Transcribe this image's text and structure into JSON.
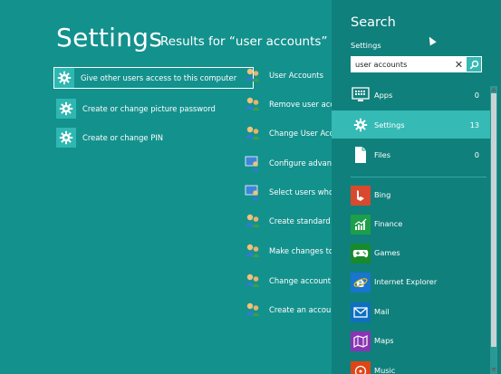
{
  "page": {
    "title": "Settings",
    "subtitle": "Results for “user accounts”"
  },
  "results_left": [
    {
      "label": "Give other users access to this computer",
      "icon": "gear-icon",
      "selected": true
    },
    {
      "label": "Create or change picture password",
      "icon": "gear-icon"
    },
    {
      "label": "Create or change PIN",
      "icon": "gear-icon"
    }
  ],
  "results_right": [
    {
      "label": "User Accounts",
      "icon": "user-accounts-icon"
    },
    {
      "label": "Remove user accoun",
      "icon": "user-accounts-icon"
    },
    {
      "label": "Change User Accou",
      "icon": "user-accounts-icon"
    },
    {
      "label": "Configure advance",
      "icon": "user-accounts-icon"
    },
    {
      "label": "Select users who ca",
      "icon": "user-accounts-icon"
    },
    {
      "label": "Create standard use",
      "icon": "user-accounts-icon"
    },
    {
      "label": "Make changes to ac",
      "icon": "user-accounts-icon"
    },
    {
      "label": "Change account typ",
      "icon": "user-accounts-icon"
    },
    {
      "label": "Create an account",
      "icon": "user-accounts-icon"
    }
  ],
  "search_pane": {
    "title": "Search",
    "scope_label": "Settings",
    "query": "user accounts",
    "categories": [
      {
        "label": "Apps",
        "count": "0",
        "icon": "apps-icon"
      },
      {
        "label": "Settings",
        "count": "13",
        "icon": "gear-icon",
        "active": true
      },
      {
        "label": "Files",
        "count": "0",
        "icon": "file-icon"
      }
    ],
    "apps": [
      {
        "label": "Bing",
        "icon": "bing-icon",
        "color": "#d9492e"
      },
      {
        "label": "Finance",
        "icon": "finance-icon",
        "color": "#1d9e48"
      },
      {
        "label": "Games",
        "icon": "games-icon",
        "color": "#178a2c"
      },
      {
        "label": "Internet Explorer",
        "icon": "internet-explorer-icon",
        "color": "#1a74d1"
      },
      {
        "label": "Mail",
        "icon": "mail-icon",
        "color": "#0e6fc1"
      },
      {
        "label": "Maps",
        "icon": "maps-icon",
        "color": "#8a34b4"
      },
      {
        "label": "Music",
        "icon": "music-icon",
        "color": "#df4516"
      }
    ]
  },
  "colors": {
    "background": "#13918d",
    "pane": "#10807c",
    "highlight": "#35bab5"
  }
}
